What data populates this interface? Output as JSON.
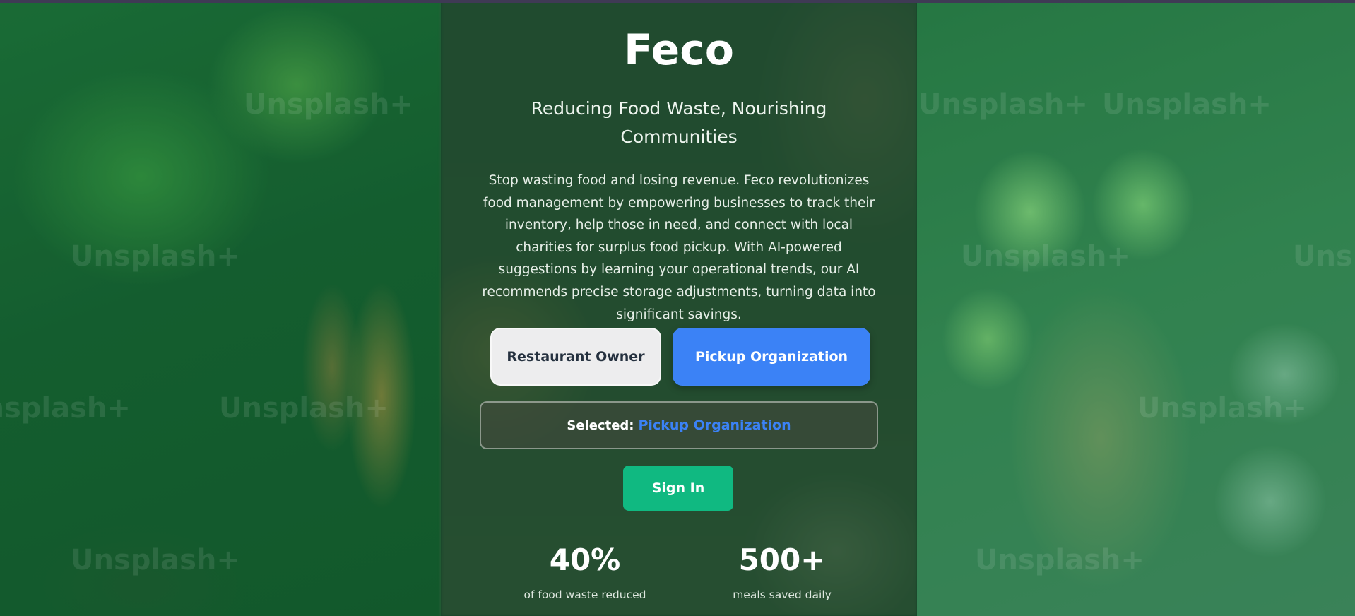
{
  "app": {
    "title": "Feco",
    "subtitle": "Reducing Food Waste, Nourishing Communities",
    "description": "Stop wasting food and losing revenue. Feco revolutionizes food management by empowering businesses to track their inventory, help those in need, and connect with local charities for surplus food pickup. With AI-powered suggestions by learning your operational trends, our AI recommends precise storage adjustments, turning data into significant savings."
  },
  "roles": {
    "owner_label": "Restaurant Owner",
    "pickup_label": "Pickup Organization",
    "selected_prefix": "Selected:",
    "selected_value": "Pickup Organization"
  },
  "auth": {
    "signin_label": "Sign In"
  },
  "stats": [
    {
      "value": "40%",
      "label": "of food waste reduced"
    },
    {
      "value": "500+",
      "label": "meals saved daily"
    }
  ],
  "watermark": {
    "text": "Unsplash+"
  },
  "colors": {
    "accent_blue": "#3b82f6",
    "signin_green": "#10b981",
    "owner_button_bg": "#ededee"
  }
}
